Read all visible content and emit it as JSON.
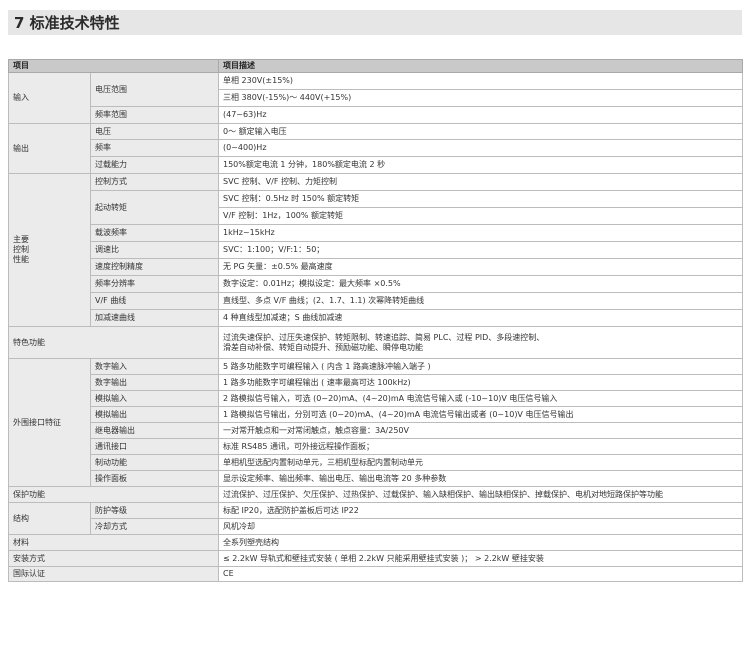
{
  "section_title": "7 标准技术特性",
  "header": {
    "item": "项目",
    "description": "项目描述"
  },
  "rows": {
    "input": {
      "label": "输入",
      "voltage_range": {
        "label": "电压范围",
        "v1": "单相 230V(±15%)",
        "v2": "三相 380V(-15%)～ 440V(+15%)"
      },
      "frequency_range": {
        "label": "频率范围",
        "v": "(47~63)Hz"
      }
    },
    "output": {
      "label": "输出",
      "voltage": {
        "label": "电压",
        "v": "0～ 额定输入电压"
      },
      "frequency": {
        "label": "频率",
        "v": " (0~400)Hz"
      },
      "overload": {
        "label": "过载能力",
        "v": "150%额定电流 1 分钟，180%额定电流 2 秒"
      }
    },
    "control": {
      "label_lines": [
        "主要",
        "控制",
        "性能"
      ],
      "mode": {
        "label": "控制方式",
        "v": "SVC 控制、V/F 控制、力矩控制"
      },
      "start_torque": {
        "label": "起动转矩",
        "v1": "SVC 控制：0.5Hz 时 150% 额定转矩",
        "v2": "V/F 控制：1Hz，100% 额定转矩"
      },
      "carrier": {
        "label": "载波频率",
        "v": "1kHz~15kHz"
      },
      "speed_ratio": {
        "label": "调速比",
        "v": "SVC：1:100；V/F:1：50；"
      },
      "speed_accuracy": {
        "label": "速度控制精度",
        "v": "无 PG 矢量：±0.5% 最高速度"
      },
      "freq_resolution": {
        "label": "频率分辨率",
        "v": "数字设定：0.01Hz；模拟设定：最大频率 ×0.5%"
      },
      "vf_curve": {
        "label": "V/F 曲线",
        "v": "直线型、多点 V/F 曲线；(2、1.7、1.1) 次幂降转矩曲线"
      },
      "accel_curve": {
        "label": "加减速曲线",
        "v": "4 种直线型加减速；S 曲线加减速"
      }
    },
    "features": {
      "label": "特色功能",
      "v1": "过流失速保护、过压失速保护、转矩限制、转速追踪、简易 PLC、过程 PID、多段速控制、",
      "v2": "滑差自动补偿、转矩自动提升、预励磁功能、瞬停电功能"
    },
    "io": {
      "label": "外围接口特征",
      "digital_in": {
        "label": "数字输入",
        "v": "5 路多功能数字可编程输入 ( 内含 1 路高速脉冲输入端子 )"
      },
      "digital_out": {
        "label": "数字输出",
        "v": "1 路多功能数字可编程输出 ( 速率最高可达 100kHz)"
      },
      "analog_in": {
        "label": "模拟输入",
        "v": "2 路模拟信号输入，可选 (0~20)mA、(4~20)mA 电流信号输入或 (-10~10)V 电压信号输入"
      },
      "analog_out": {
        "label": "模拟输出",
        "v": "1 路模拟信号输出，分别可选 (0~20)mA、(4~20)mA 电流信号输出或者 (0~10)V 电压信号输出"
      },
      "relay_out": {
        "label": "继电器输出",
        "v": "一对常开触点和一对常闭触点，触点容量：3A/250V"
      },
      "comm": {
        "label": "通讯接口",
        "v": "标准 RS485 通讯，可外接远程操作面板；"
      },
      "braking": {
        "label": "制动功能",
        "v": "单相机型选配内置制动单元，三相机型标配内置制动单元"
      },
      "panel": {
        "label": "操作面板",
        "v": "显示设定频率、输出频率、输出电压、输出电流等 20 多种参数"
      }
    },
    "protection": {
      "label": "保护功能",
      "v": "过流保护、过压保护、欠压保护、过热保护、过载保护、输入缺相保护、输出缺相保护、掉载保护、电机对地短路保护等功能"
    },
    "structure": {
      "label": "结构",
      "ip": {
        "label": "防护等级",
        "v": "标配 IP20，选配防护盖板后可达 IP22"
      },
      "cooling": {
        "label": "冷却方式",
        "v": "风机冷却"
      }
    },
    "material": {
      "label": "材料",
      "v": "全系列塑壳结构"
    },
    "install": {
      "label": "安装方式",
      "v": "≤ 2.2kW 导轨式和壁挂式安装 ( 单相 2.2kW 只能采用壁挂式安装 )；  > 2.2kW 壁挂安装"
    },
    "cert": {
      "label": "国际认证",
      "v": "CE"
    }
  }
}
